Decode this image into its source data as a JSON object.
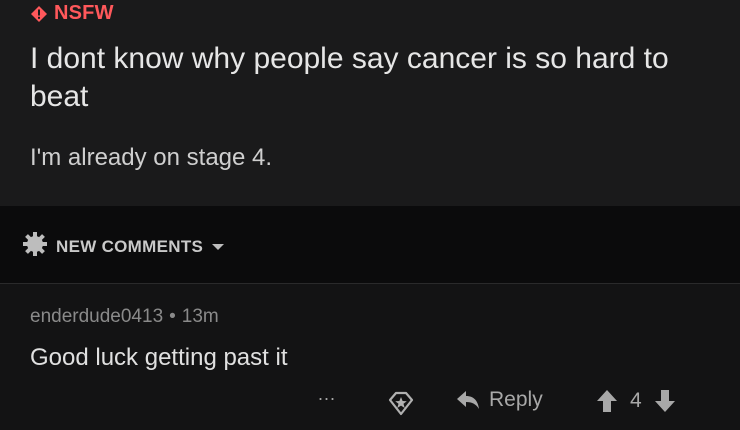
{
  "post": {
    "nsfw_label": "NSFW",
    "title": "I dont know why people say cancer is so hard to beat",
    "body": "I'm already on stage 4."
  },
  "sort": {
    "label": "NEW COMMENTS"
  },
  "comment": {
    "author": "enderdude0413",
    "separator": "•",
    "age": "13m",
    "text": "Good luck getting past it"
  },
  "comment_actions": {
    "more": "...",
    "reply_label": "Reply",
    "score": "4"
  },
  "colors": {
    "nsfw": "#ff585b",
    "post_bg": "#1a1a1b",
    "page_bg": "#0b0b0c",
    "comment_bg": "#131314"
  },
  "icons": [
    "nsfw-diamond-icon",
    "sort-gear-icon",
    "chevron-down-icon",
    "more-icon",
    "award-icon",
    "reply-icon",
    "upvote-icon",
    "downvote-icon"
  ]
}
